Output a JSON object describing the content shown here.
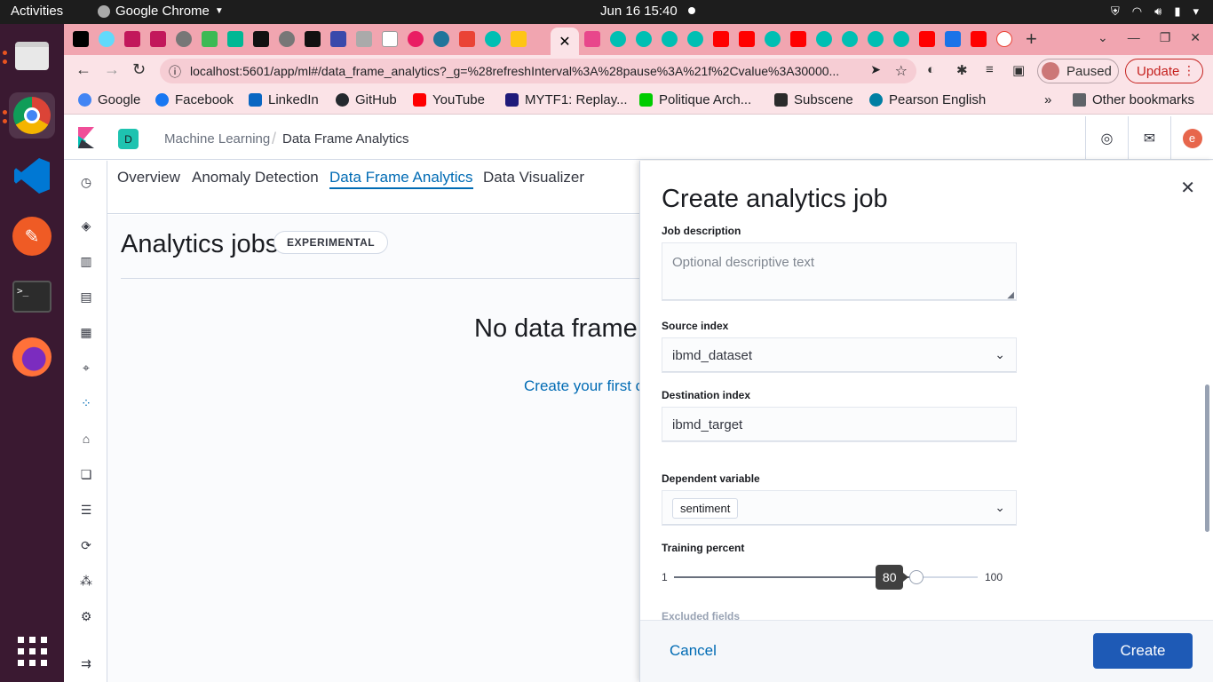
{
  "os": {
    "activities": "Activities",
    "app_name": "Google Chrome",
    "clock": "Jun 16  15:40"
  },
  "browser": {
    "url": "localhost:5601/app/ml#/data_frame_analytics?_g=%28refreshInterval%3A%28pause%3A%21f%2Cvalue%3A30000...",
    "profile_label": "Paused",
    "update_label": "Update",
    "bookmarks": [
      {
        "label": "Google",
        "color": "#4285f4"
      },
      {
        "label": "Facebook",
        "color": "#1877f2"
      },
      {
        "label": "LinkedIn",
        "color": "#0a66c2"
      },
      {
        "label": "GitHub",
        "color": "#24292e"
      },
      {
        "label": "YouTube",
        "color": "#ff0000"
      },
      {
        "label": "MYTF1: Replay...",
        "color": "#1f1a7a"
      },
      {
        "label": "Politique Arch...",
        "color": "#00cc00"
      },
      {
        "label": "Subscene",
        "color": "#2b2b2b"
      },
      {
        "label": "Pearson English",
        "color": "#007fa3"
      }
    ],
    "other_bookmarks": "Other bookmarks",
    "more": "»"
  },
  "kibana": {
    "space_initial": "D",
    "breadcrumb_parent": "Machine Learning",
    "breadcrumb_current": "Data Frame Analytics",
    "user_initial": "e",
    "tabs": [
      "Overview",
      "Anomaly Detection",
      "Data Frame Analytics",
      "Data Visualizer"
    ],
    "selected_tab": "Data Frame Analytics",
    "page_title": "Analytics jobs",
    "badge": "EXPERIMENTAL",
    "empty_title": "No data frame a",
    "empty_link": "Create your first c"
  },
  "flyout": {
    "title": "Create analytics job",
    "job_description": {
      "label": "Job description",
      "placeholder": "Optional descriptive text"
    },
    "source_index": {
      "label": "Source index",
      "value": "ibmd_dataset"
    },
    "destination_index": {
      "label": "Destination index",
      "value": "ibmd_target"
    },
    "dependent_variable": {
      "label": "Dependent variable",
      "value": "sentiment"
    },
    "training_percent": {
      "label": "Training percent",
      "min": "1",
      "max": "100",
      "value": "80"
    },
    "next_section_label": "Excluded fields",
    "cancel": "Cancel",
    "create": "Create"
  }
}
